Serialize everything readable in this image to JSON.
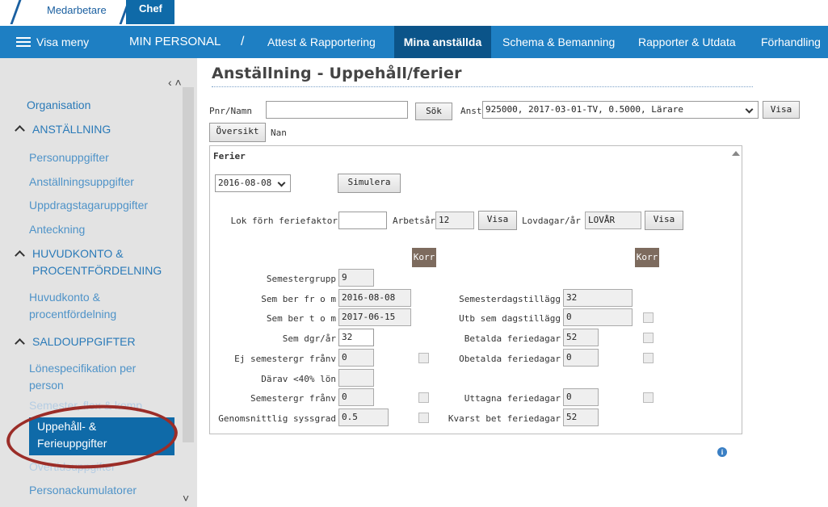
{
  "role_tabs": [
    {
      "label": "Medarbetare",
      "active": false
    },
    {
      "label": "Chef",
      "active": true
    }
  ],
  "nav": {
    "menu_label": "Visa meny",
    "section": "MIN PERSONAL",
    "separator": "/",
    "items": [
      {
        "label": "Attest & Rapportering",
        "active": false
      },
      {
        "label": "Mina anställda",
        "active": true
      },
      {
        "label": "Schema & Bemanning",
        "active": false
      },
      {
        "label": "Rapporter & Utdata",
        "active": false
      },
      {
        "label": "Förhandling",
        "active": false
      }
    ]
  },
  "sidebar": {
    "organisation": "Organisation",
    "sections": [
      {
        "title": "ANSTÄLLNING",
        "items": [
          "Personuppgifter",
          "Anställningsuppgifter",
          "Uppdragstagaruppgifter",
          "Anteckning"
        ]
      },
      {
        "title_line1": "HUVUDKONTO &",
        "title_line2": "PROCENTFÖRDELNING",
        "items_line1": "Huvudkonto &",
        "items_line2": "procentfördelning"
      },
      {
        "title": "SALDOUPPGIFTER",
        "lonespec_line1": "Lönespecifikation per",
        "lonespec_line2": "person",
        "semester": "Semester, flex & komp",
        "active_line1": "Uppehåll- &",
        "active_line2": "Ferieuppgifter",
        "overtid": "Övertidsuppgifter",
        "personack": "Personackumulatorer"
      }
    ]
  },
  "page": {
    "title": "Anställning - Uppehåll/ferier",
    "pnr_label": "Pnr/Namn",
    "pnr_value": "",
    "sok_button": "Sök",
    "anst_label": "Anst",
    "anst_value": "925000, 2017-03-01-TV, 0.5000, Lärare",
    "visa_button": "Visa",
    "oversikt_button": "Översikt",
    "name_value": "Nan"
  },
  "ferier": {
    "heading": "Ferier",
    "date_select": "2016-08-08",
    "simulera_button": "Simulera",
    "lok_label": "Lok förh feriefaktor",
    "lok_value": "",
    "arbetsar_label": "Arbetsår",
    "arbetsar_value": "12",
    "visa1": "Visa",
    "lovdagar_label": "Lovdagar/år",
    "lovdagar_value": "LOVÅR",
    "visa2": "Visa",
    "korr_label": "Korr",
    "left": [
      {
        "label": "Semestergrupp",
        "value": "9"
      },
      {
        "label": "Sem ber fr o m",
        "value": "2016-08-08"
      },
      {
        "label": "Sem ber t o m",
        "value": "2017-06-15"
      },
      {
        "label": "Sem dgr/år",
        "value": "32"
      },
      {
        "label": "Ej semestergr frånv",
        "value": "0"
      },
      {
        "label": "Därav <40% lön",
        "value": ""
      },
      {
        "label": "Semestergr frånv",
        "value": "0"
      },
      {
        "label": "Genomsnittlig syssgrad",
        "value": "0.5"
      }
    ],
    "right": [
      {
        "label": "Semesterdagstillägg",
        "value": "32"
      },
      {
        "label": "Utb sem dagstillägg",
        "value": "0"
      },
      {
        "label": "Betalda feriedagar",
        "value": "52"
      },
      {
        "label": "Obetalda feriedagar",
        "value": "0"
      },
      {
        "label": "Uttagna feriedagar",
        "value": "0"
      },
      {
        "label": "Kvarst bet feriedagar",
        "value": "52"
      }
    ]
  },
  "colors": {
    "nav": "#1e7fc3",
    "nav_active": "#0b5489",
    "highlight_oval": "#9b2d28"
  }
}
